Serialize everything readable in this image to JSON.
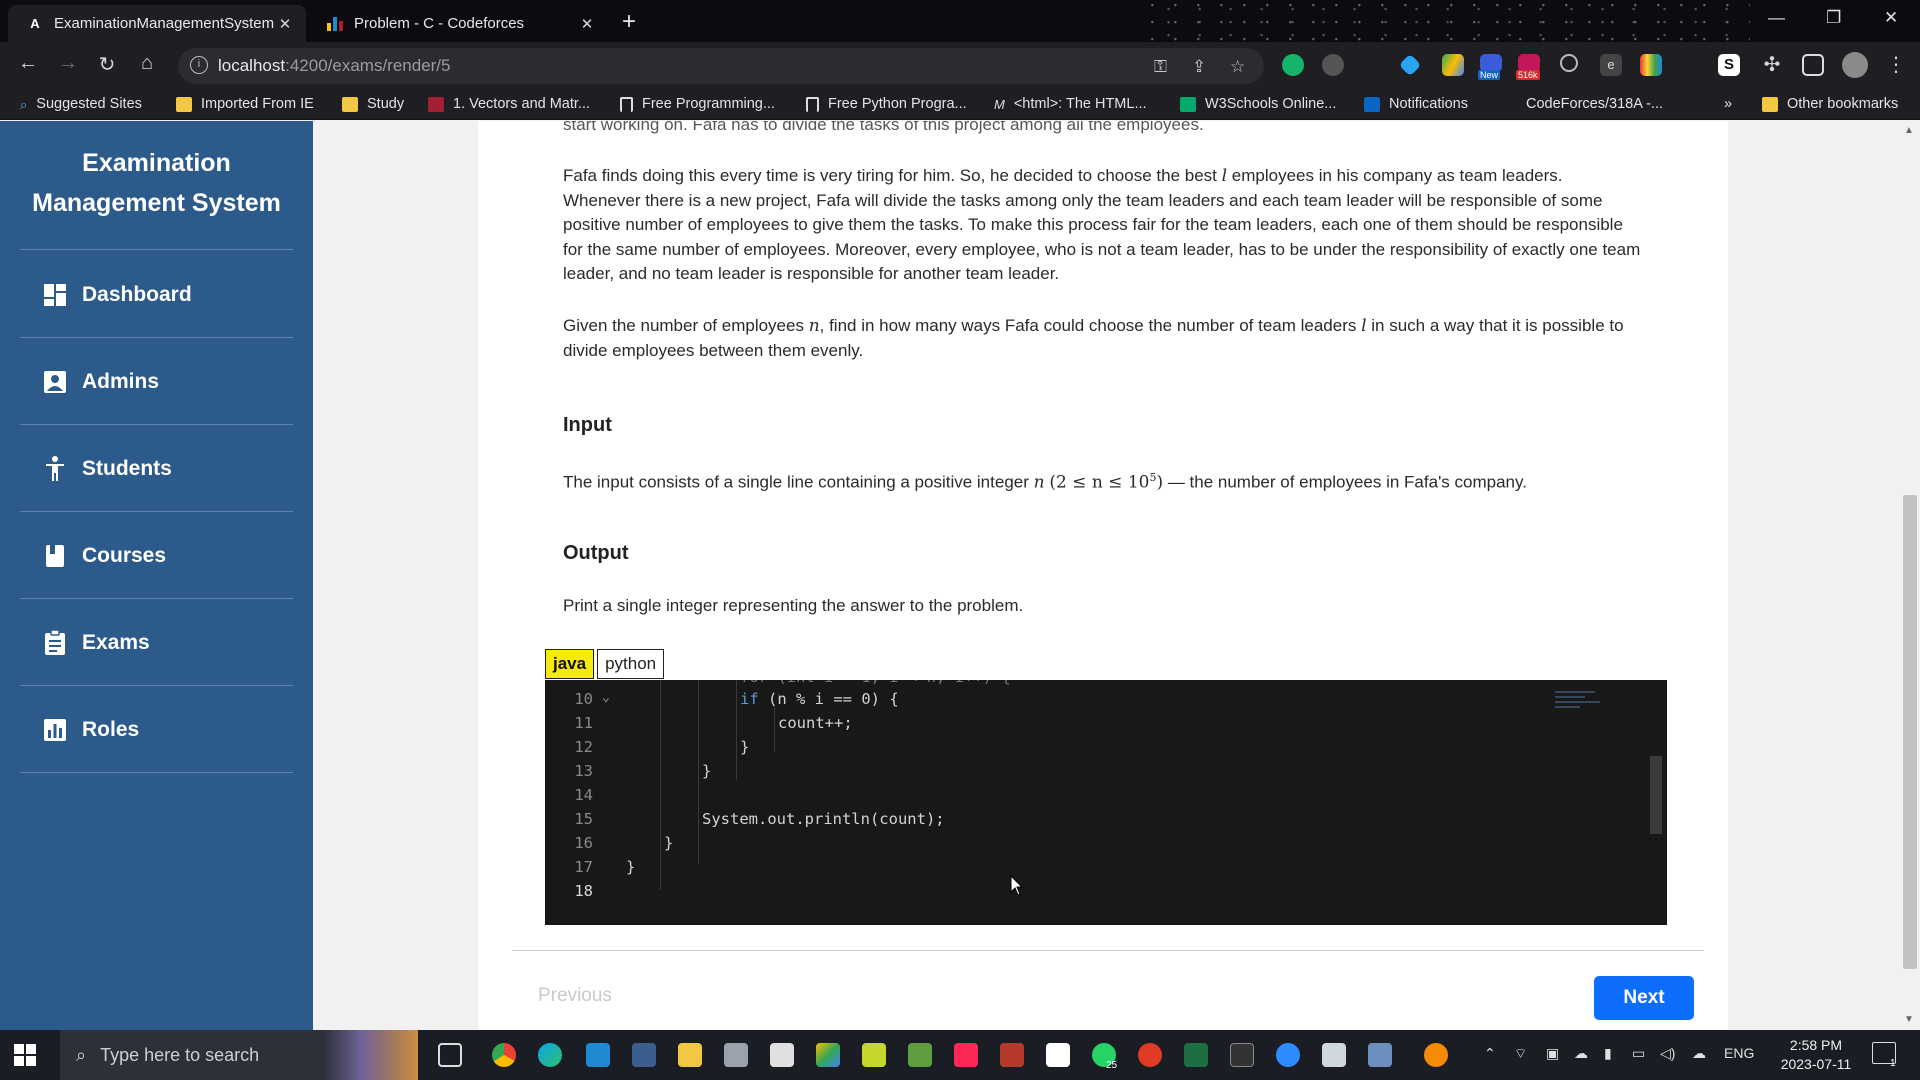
{
  "browser": {
    "tabs": [
      {
        "title": "ExaminationManagementSystem",
        "favicon": "A",
        "active": true
      },
      {
        "title": "Problem - C - Codeforces",
        "favicon": "bar-chart",
        "active": false
      }
    ],
    "url_host": "localhost",
    "url_path": ":4200/exams/render/5",
    "bookmarks": [
      "Suggested Sites",
      "Imported From IE",
      "Study",
      "1. Vectors and Matr...",
      "Free Programming...",
      "Free Python Progra...",
      "<html>: The HTML...",
      "W3Schools Online...",
      "Notifications",
      "CodeForces/318A -...",
      "Other bookmarks"
    ],
    "bookmarks_more": "»",
    "ext_badges": {
      "new": "New",
      "count": "516k"
    }
  },
  "sidebar": {
    "title": "Examination Management System",
    "items": [
      {
        "label": "Dashboard",
        "icon": "dashboard-icon"
      },
      {
        "label": "Admins",
        "icon": "admin-icon"
      },
      {
        "label": "Students",
        "icon": "student-icon"
      },
      {
        "label": "Courses",
        "icon": "book-icon"
      },
      {
        "label": "Exams",
        "icon": "clipboard-icon"
      },
      {
        "label": "Roles",
        "icon": "chart-icon"
      }
    ]
  },
  "problem": {
    "cutoff_line": "start working on. Fafa has to divide the tasks of this project among all the employees.",
    "p1_a": "Fafa finds doing this every time is very tiring for him. So, he decided to choose the best ",
    "p1_var": "l",
    "p1_b": " employees in his company as team leaders. Whenever there is a new project, Fafa will divide the tasks among only the team leaders and each team leader will be responsible of some positive number of employees to give them the tasks. To make this process fair for the team leaders, each one of them should be responsible for the same number of employees. Moreover, every employee, who is not a team leader, has to be under the responsibility of exactly one team leader, and no team leader is responsible for another team leader.",
    "p2_a": "Given the number of employees ",
    "p2_var1": "n",
    "p2_b": ", find in how many ways Fafa could choose the number of team leaders ",
    "p2_var2": "l",
    "p2_c": " in such a way that it is possible to divide employees between them evenly.",
    "input_heading": "Input",
    "input_a": "The input consists of a single line containing a positive integer ",
    "input_var": "n",
    "input_constraint": "(2 ≤ n ≤ 10",
    "input_exp": "5",
    "input_close": ")",
    "input_b": " — the number of employees in Fafa's company.",
    "output_heading": "Output",
    "output_text": "Print a single integer representing the answer to the problem."
  },
  "editor": {
    "languages": [
      "java",
      "python"
    ],
    "active_language": "java",
    "lines": [
      {
        "n": "10",
        "text": "if (n % i == 0) {",
        "indent": 3,
        "fold": true
      },
      {
        "n": "11",
        "text": "count++;",
        "indent": 4
      },
      {
        "n": "12",
        "text": "}",
        "indent": 3
      },
      {
        "n": "13",
        "text": "}",
        "indent": 2
      },
      {
        "n": "14",
        "text": "",
        "indent": 0
      },
      {
        "n": "15",
        "text": "System.out.println(count);",
        "indent": 2
      },
      {
        "n": "16",
        "text": "}",
        "indent": 1
      },
      {
        "n": "17",
        "text": "}",
        "indent": 0
      },
      {
        "n": "18",
        "text": "",
        "indent": 0,
        "current": true
      }
    ]
  },
  "nav": {
    "previous": "Previous",
    "next": "Next"
  },
  "taskbar": {
    "search_placeholder": "Type here to search",
    "language": "ENG",
    "time": "2:58 PM",
    "date": "2023-07-11",
    "whatsapp_badge": "25",
    "notif_count": "1"
  },
  "colors": {
    "sidebar": "#2c5a8a",
    "next_button": "#0d6efd",
    "java_tab": "#f6e90d",
    "editor_bg": "#181818"
  }
}
